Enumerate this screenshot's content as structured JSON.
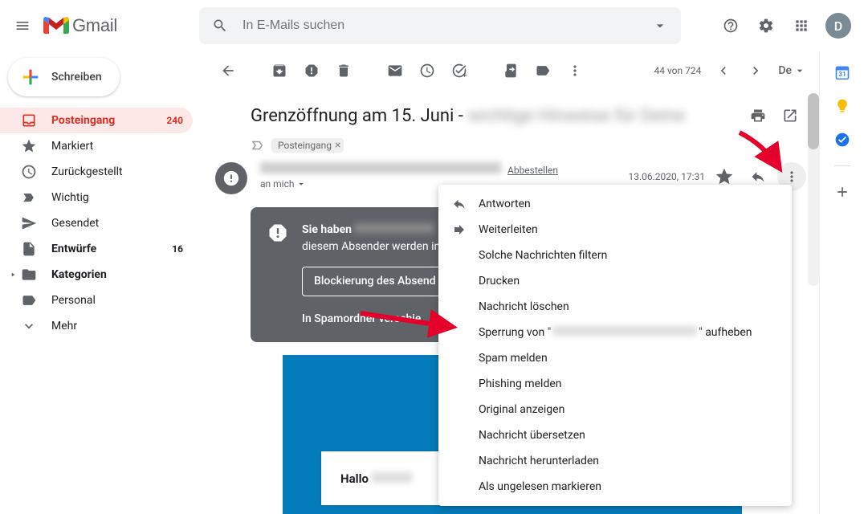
{
  "header": {
    "app_name": "Gmail",
    "search_placeholder": "In E-Mails suchen",
    "avatar_letter": "D"
  },
  "compose": {
    "label": "Schreiben"
  },
  "sidebar": {
    "items": [
      {
        "label": "Posteingang",
        "count": "240"
      },
      {
        "label": "Markiert",
        "count": ""
      },
      {
        "label": "Zurückgestellt",
        "count": ""
      },
      {
        "label": "Wichtig",
        "count": ""
      },
      {
        "label": "Gesendet",
        "count": ""
      },
      {
        "label": "Entwürfe",
        "count": "16"
      },
      {
        "label": "Kategorien",
        "count": ""
      },
      {
        "label": "Personal",
        "count": ""
      },
      {
        "label": "Mehr",
        "count": ""
      }
    ]
  },
  "toolbar": {
    "pager": "44 von 724",
    "lang": "De"
  },
  "message": {
    "subject_prefix": "Grenzöffnung am 15. Juni - ",
    "label_chip": "Posteingang",
    "unsubscribe": "Abbestellen",
    "date": "13.06.2020, 17:31",
    "to_prefix": "an mich"
  },
  "banner": {
    "line1_prefix": "Sie haben ",
    "line2": "diesem Absender werden in",
    "button": "Blockierung des Absend",
    "link": "In Spamordner verschie"
  },
  "body_content": {
    "greeting": "Hallo "
  },
  "menu": {
    "items": [
      "Antworten",
      "Weiterleiten",
      "Solche Nachrichten filtern",
      "Drucken",
      "Nachricht löschen",
      "",
      "Spam melden",
      "Phishing melden",
      "Original anzeigen",
      "Nachricht übersetzen",
      "Nachricht herunterladen",
      "Als ungelesen markieren"
    ],
    "unblock_prefix": "Sperrung von \"",
    "unblock_suffix": "\" aufheben"
  }
}
